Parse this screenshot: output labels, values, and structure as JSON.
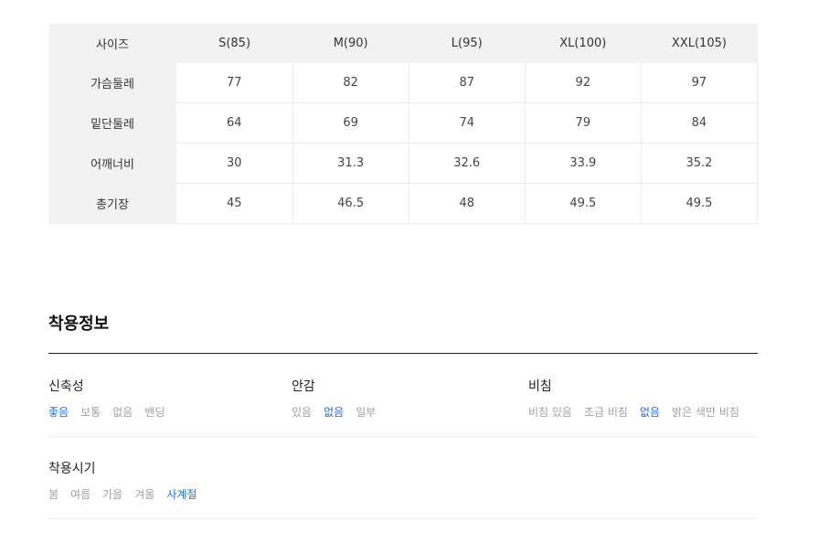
{
  "size_table": {
    "header": [
      "사이즈",
      "S(85)",
      "M(90)",
      "L(95)",
      "XL(100)",
      "XXL(105)"
    ],
    "rows": [
      {
        "label": "가슴둘레",
        "values": [
          "77",
          "82",
          "87",
          "92",
          "97"
        ]
      },
      {
        "label": "밑단둘레",
        "values": [
          "64",
          "69",
          "74",
          "79",
          "84"
        ]
      },
      {
        "label": "어깨너비",
        "values": [
          "30",
          "31.3",
          "32.6",
          "33.9",
          "35.2"
        ]
      },
      {
        "label": "총기장",
        "values": [
          "45",
          "46.5",
          "48",
          "49.5",
          "49.5"
        ]
      }
    ]
  },
  "fit_info": {
    "title": "착용정보",
    "groups": [
      {
        "label": "신축성",
        "options": [
          "좋음",
          "보통",
          "없음",
          "밴딩"
        ],
        "selected": "좋음"
      },
      {
        "label": "안감",
        "options": [
          "있음",
          "없음",
          "일부"
        ],
        "selected": "없음"
      },
      {
        "label": "비침",
        "options": [
          "비침 있음",
          "조금 비침",
          "없음",
          "밝은 색만 비침"
        ],
        "selected": "없음"
      },
      {
        "label": "착용시기",
        "options": [
          "봄",
          "여름",
          "가을",
          "겨울",
          "사계절"
        ],
        "selected": "사계절"
      }
    ]
  },
  "colors": {
    "selected": "#1f6fe0",
    "unselected": "#a0a0a0",
    "header_bg": "#f2f2f2"
  }
}
